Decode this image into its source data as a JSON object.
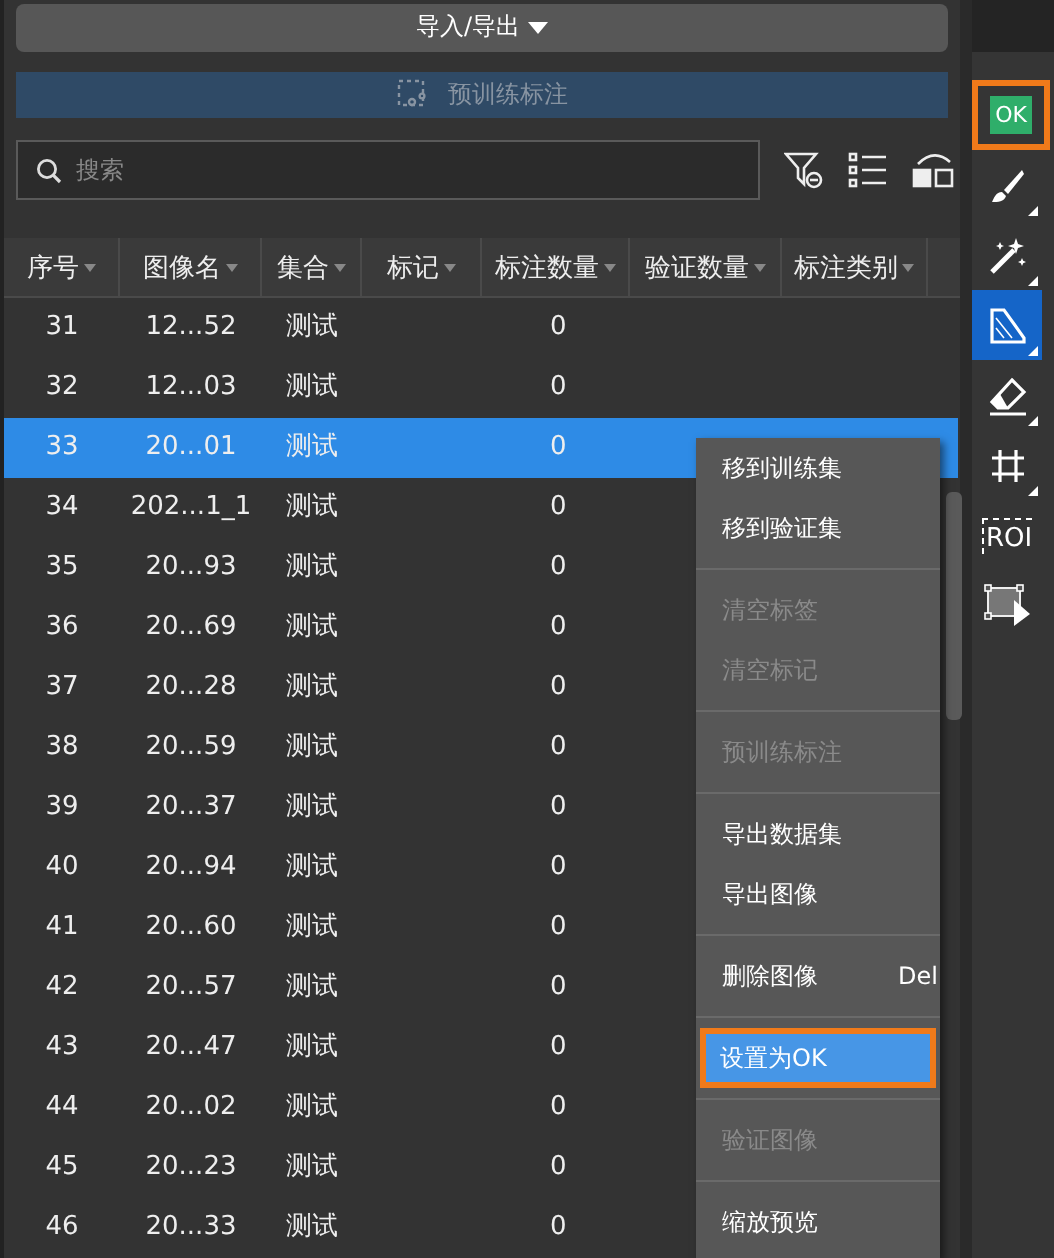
{
  "import_export": {
    "label": "导入/导出"
  },
  "pretrain_button": {
    "label": "预训练标注",
    "disabled": true
  },
  "search": {
    "placeholder": "搜索"
  },
  "table": {
    "columns": [
      "序号",
      "图像名",
      "集合",
      "标记",
      "标注数量",
      "验证数量",
      "标注类别"
    ],
    "rows": [
      {
        "index": "31",
        "name": "12...52",
        "set": "测试",
        "count": "0",
        "selected": false
      },
      {
        "index": "32",
        "name": "12...03",
        "set": "测试",
        "count": "0",
        "selected": false
      },
      {
        "index": "33",
        "name": "20...01",
        "set": "测试",
        "count": "0",
        "selected": true
      },
      {
        "index": "34",
        "name": "202...1_1",
        "set": "测试",
        "count": "0",
        "selected": false
      },
      {
        "index": "35",
        "name": "20...93",
        "set": "测试",
        "count": "0",
        "selected": false
      },
      {
        "index": "36",
        "name": "20...69",
        "set": "测试",
        "count": "0",
        "selected": false
      },
      {
        "index": "37",
        "name": "20...28",
        "set": "测试",
        "count": "0",
        "selected": false
      },
      {
        "index": "38",
        "name": "20...59",
        "set": "测试",
        "count": "0",
        "selected": false
      },
      {
        "index": "39",
        "name": "20...37",
        "set": "测试",
        "count": "0",
        "selected": false
      },
      {
        "index": "40",
        "name": "20...94",
        "set": "测试",
        "count": "0",
        "selected": false
      },
      {
        "index": "41",
        "name": "20...60",
        "set": "测试",
        "count": "0",
        "selected": false
      },
      {
        "index": "42",
        "name": "20...57",
        "set": "测试",
        "count": "0",
        "selected": false
      },
      {
        "index": "43",
        "name": "20...47",
        "set": "测试",
        "count": "0",
        "selected": false
      },
      {
        "index": "44",
        "name": "20...02",
        "set": "测试",
        "count": "0",
        "selected": false
      },
      {
        "index": "45",
        "name": "20...23",
        "set": "测试",
        "count": "0",
        "selected": false
      },
      {
        "index": "46",
        "name": "20...33",
        "set": "测试",
        "count": "0",
        "selected": false
      }
    ]
  },
  "context_menu": [
    {
      "kind": "item",
      "label": "移到训练集",
      "disabled": false,
      "selected": false,
      "highlighted": false
    },
    {
      "kind": "item",
      "label": "移到验证集",
      "disabled": false,
      "selected": false,
      "highlighted": false
    },
    {
      "kind": "separator"
    },
    {
      "kind": "item",
      "label": "清空标签",
      "disabled": true,
      "selected": false,
      "highlighted": false
    },
    {
      "kind": "item",
      "label": "清空标记",
      "disabled": true,
      "selected": false,
      "highlighted": false
    },
    {
      "kind": "separator"
    },
    {
      "kind": "item",
      "label": "预训练标注",
      "disabled": true,
      "selected": false,
      "highlighted": false
    },
    {
      "kind": "separator"
    },
    {
      "kind": "item",
      "label": "导出数据集",
      "disabled": false,
      "selected": false,
      "highlighted": false
    },
    {
      "kind": "item",
      "label": "导出图像",
      "disabled": false,
      "selected": false,
      "highlighted": false
    },
    {
      "kind": "separator"
    },
    {
      "kind": "item",
      "label": "删除图像",
      "shortcut": "Del",
      "disabled": false,
      "selected": false,
      "highlighted": false
    },
    {
      "kind": "separator"
    },
    {
      "kind": "item",
      "label": "设置为OK",
      "disabled": false,
      "selected": true,
      "highlighted": true
    },
    {
      "kind": "separator"
    },
    {
      "kind": "item",
      "label": "验证图像",
      "disabled": true,
      "selected": false,
      "highlighted": false
    },
    {
      "kind": "separator"
    },
    {
      "kind": "item",
      "label": "缩放预览",
      "disabled": false,
      "selected": false,
      "highlighted": false
    }
  ],
  "toolbar": [
    {
      "kind": "ok",
      "label": "OK",
      "selected": false,
      "highlighted": true
    },
    {
      "kind": "brush",
      "selected": false,
      "highlighted": false
    },
    {
      "kind": "wand",
      "selected": false,
      "highlighted": false
    },
    {
      "kind": "polygon",
      "selected": true,
      "highlighted": false
    },
    {
      "kind": "eraser",
      "selected": false,
      "highlighted": false
    },
    {
      "kind": "grid",
      "selected": false,
      "highlighted": false
    },
    {
      "kind": "roi",
      "label": "ROI",
      "selected": false,
      "highlighted": false
    },
    {
      "kind": "rect",
      "selected": false,
      "highlighted": false
    }
  ]
}
